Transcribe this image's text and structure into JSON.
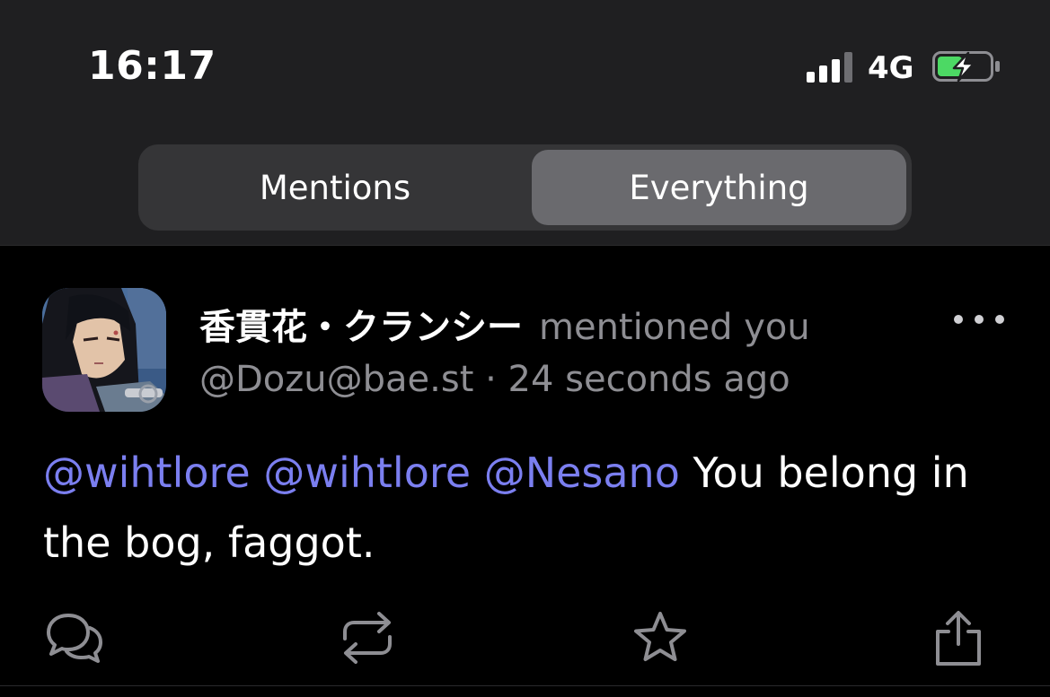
{
  "status_bar": {
    "time": "16:17",
    "network": "4G",
    "battery_color": "#4cd964"
  },
  "tabs": {
    "items": [
      {
        "label": "Mentions",
        "selected": false
      },
      {
        "label": "Everything",
        "selected": true
      }
    ]
  },
  "notification": {
    "display_name": "香貫花・クランシー",
    "action_text": "mentioned you",
    "handle": "@Dozu@bae.st",
    "separator": "·",
    "time_ago": "24 seconds ago",
    "mentions": [
      "@wihtlore",
      "@wihtlore",
      "@Nesano"
    ],
    "body_text": "You belong in the bog, faggot."
  },
  "actions": {
    "icons": [
      "reply-icon",
      "boost-icon",
      "favourite-icon",
      "share-icon"
    ]
  },
  "colors": {
    "mention": "#7b7ff0",
    "secondary_text": "#8e8e93",
    "header_bg": "#1f1f21",
    "segment_selected": "#6a6a6e"
  }
}
